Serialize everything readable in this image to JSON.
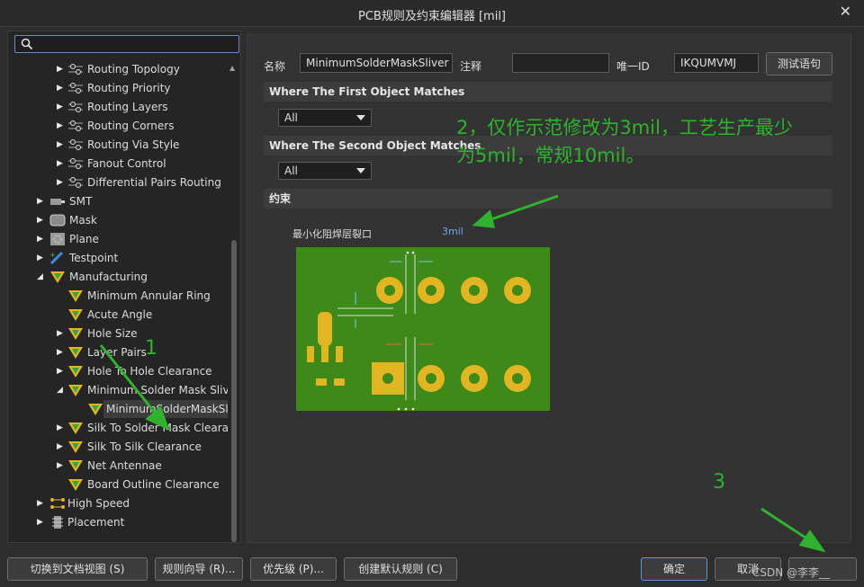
{
  "window": {
    "title": "PCB规则及约束编辑器 [mil]",
    "close_glyph": "✕"
  },
  "tree": {
    "items": [
      {
        "label": "Routing Topology"
      },
      {
        "label": "Routing Priority"
      },
      {
        "label": "Routing Layers"
      },
      {
        "label": "Routing Corners"
      },
      {
        "label": "Routing Via Style"
      },
      {
        "label": "Fanout Control"
      },
      {
        "label": "Differential Pairs Routing"
      },
      {
        "label": "SMT"
      },
      {
        "label": "Mask"
      },
      {
        "label": "Plane"
      },
      {
        "label": "Testpoint"
      },
      {
        "label": "Manufacturing"
      },
      {
        "label": "Minimum Annular Ring"
      },
      {
        "label": "Acute Angle"
      },
      {
        "label": "Hole Size"
      },
      {
        "label": "Layer Pairs"
      },
      {
        "label": "Hole To Hole Clearance"
      },
      {
        "label": "Minimum Solder Mask Sliver"
      },
      {
        "label": "MinimumSolderMaskSlive"
      },
      {
        "label": "Silk To Solder Mask Clearance"
      },
      {
        "label": "Silk To Silk Clearance"
      },
      {
        "label": "Net Antennae"
      },
      {
        "label": "Board Outline Clearance"
      },
      {
        "label": "High Speed"
      },
      {
        "label": "Placement"
      }
    ]
  },
  "rule": {
    "name_label": "名称",
    "name_value": "MinimumSolderMaskSliver",
    "comment_label": "注释",
    "comment_value": "",
    "id_label": "唯一ID",
    "id_value": "IKQUMVMJ",
    "test_button": "测试语句",
    "first_match_header": "Where The First Object Matches",
    "first_match_value": "All",
    "second_match_header": "Where The Second Object Matches",
    "second_match_value": "All",
    "constraints_header": "约束",
    "constraint_label": "最小化阻焊层裂口",
    "constraint_value": "3mil"
  },
  "annotations": {
    "note_line1": "2，仅作示范修改为3mil，工艺生产最少",
    "note_line2": "为5mil，常规10mil。",
    "marker1": "1",
    "marker3": "3",
    "color": "#2fb32f"
  },
  "bottom": {
    "switch_doc_view": "切换到文档视图 (S)",
    "rule_wizard": "规则向导 (R)...",
    "priorities": "优先级 (P)...",
    "create_default": "创建默认规则 (C)",
    "ok": "确定",
    "cancel": "取消",
    "apply": "应用",
    "watermark": "CSDN @李李__"
  },
  "colors": {
    "board_green": "#3d8a18",
    "pad_gold": "#e3b522",
    "accent_blue": "#5b9bd5"
  }
}
